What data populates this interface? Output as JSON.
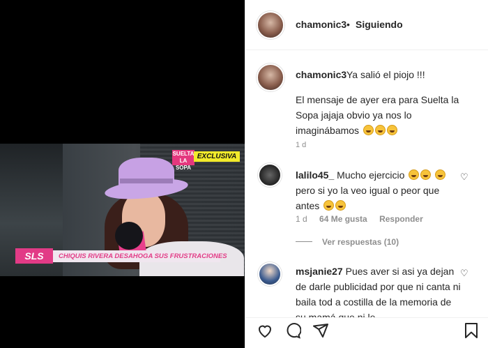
{
  "video": {
    "badge_text": "SUELTA LA SOPA",
    "exclusive_label": "EXCLUSIVA",
    "lower_third_logo": "SLS",
    "lower_third_text": "CHIQUIS RIVERA DESAHOGA SUS FRUSTRACIONES"
  },
  "header": {
    "username": "chamonic3",
    "separator": "•",
    "follow_status": "Siguiendo"
  },
  "caption": {
    "username": "chamonic3",
    "first_line": "Ya salió el piojo !!!",
    "body": "El mensaje de ayer era para Suelta la Sopa jajaja obvio ya nos lo imaginábamos",
    "time": "1 d"
  },
  "comments": [
    {
      "username": "lalilo45_",
      "text_part1": "Mucho ejercicio",
      "text_part2": "pero si yo la veo igual o peor que antes",
      "time": "1 d",
      "likes": "64 Me gusta",
      "reply_label": "Responder",
      "view_replies": "Ver respuestas (10)"
    },
    {
      "username": "msjanie27",
      "text": "Pues aver si asi ya dejan de darle publicidad por que ni canta ni baila tod a costilla de la memoria de su mamá que ni le"
    }
  ],
  "icons": {
    "heart": "heart-icon",
    "comment": "comment-icon",
    "share": "share-icon",
    "bookmark": "bookmark-icon"
  }
}
